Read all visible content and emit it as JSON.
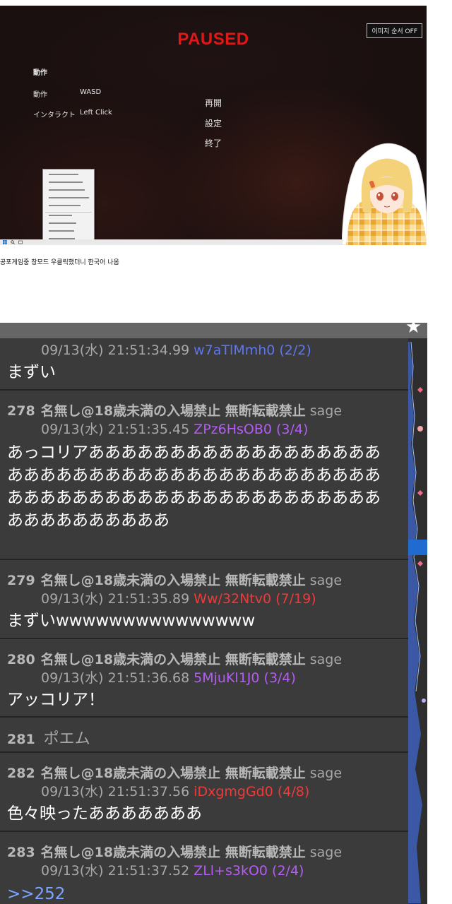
{
  "game": {
    "paused_title": "PAUSED",
    "image_order_button": "이미지 순서 OFF",
    "controls_heading": "動作",
    "controls": [
      {
        "label": "動作",
        "key": "WASD"
      },
      {
        "label": "インタラクト",
        "key": "Left Click"
      }
    ],
    "menu": [
      "再開",
      "設定",
      "終了"
    ]
  },
  "caption": "공포게임중 창모드 우클릭했더니 한국어 나옴",
  "thread": {
    "posts": [
      {
        "number": "",
        "name": "",
        "mail": "",
        "datetime": "09/13(水) 21:51:34.99",
        "id": "w7aTlMmh0 (2/2)",
        "id_color": "#5d76f0",
        "body": "まずい"
      },
      {
        "number": "278",
        "name": "名無し@18歳未満の入場禁止 無断転載禁止",
        "mail": "sage",
        "datetime": "09/13(水) 21:51:35.45",
        "id": "ZPz6HsOB0 (3/4)",
        "id_color": "#b45cf5",
        "body": "あっコリアああああああああああああああああああああああああああああああああああああああああああああああああああああああああああああああああああああああああああ"
      },
      {
        "number": "279",
        "name": "名無し@18歳未満の入場禁止 無断転載禁止",
        "mail": "sage",
        "datetime": "09/13(水) 21:51:35.89",
        "id": "Ww/32Ntv0 (7/19)",
        "id_color": "#f03a3a",
        "body": "まずいwwwwwwwwwwwwwww"
      },
      {
        "number": "280",
        "name": "名無し@18歳未満の入場禁止 無断転載禁止",
        "mail": "sage",
        "datetime": "09/13(水) 21:51:36.68",
        "id": "5MjuKl1J0 (3/4)",
        "id_color": "#b45cf5",
        "body": "アッコリア！"
      },
      {
        "number": "281",
        "name": "ポエム",
        "mail": "",
        "datetime": "",
        "id": "",
        "id_color": "#a8a8a8",
        "body": ""
      },
      {
        "number": "282",
        "name": "名無し@18歳未満の入場禁止 無断転載禁止",
        "mail": "sage",
        "datetime": "09/13(水) 21:51:37.56",
        "id": "iDxgmgGd0 (4/8)",
        "id_color": "#f03a3a",
        "body": "色々映ったあああああああ"
      },
      {
        "number": "283",
        "name": "名無し@18歳未満の入場禁止 無断転載禁止",
        "mail": "sage",
        "datetime": "09/13(水) 21:51:37.52",
        "id": "ZLl+s3kO0 (2/4)",
        "id_color": "#b45cf5",
        "body": ">>252",
        "body_color": "#7aa6ff"
      }
    ]
  }
}
